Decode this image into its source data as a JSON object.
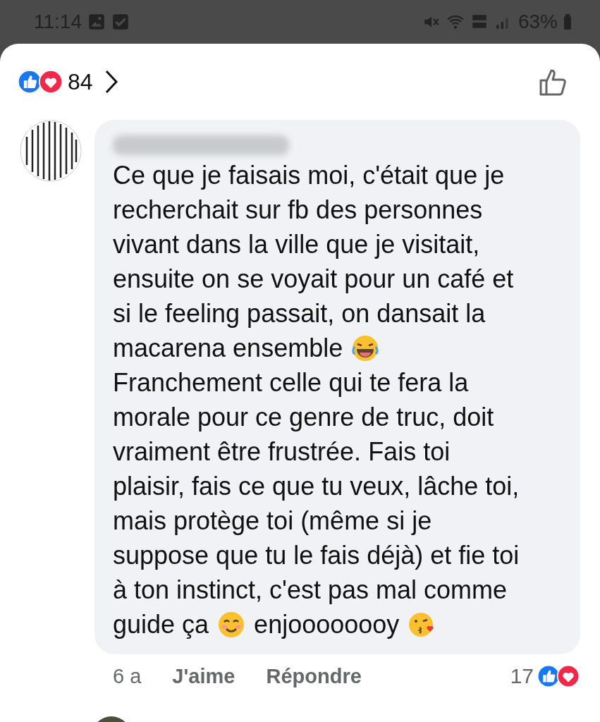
{
  "status_bar": {
    "time": "11:14",
    "battery": "63%"
  },
  "reactions_header": {
    "count": "84"
  },
  "comment": {
    "lines": [
      [
        {
          "kind": "text",
          "text": "Ce que je faisais moi, c'était que je"
        }
      ],
      [
        {
          "kind": "text",
          "text": "recherchait sur fb des personnes"
        }
      ],
      [
        {
          "kind": "text",
          "text": "vivant dans la ville que je visitait,"
        }
      ],
      [
        {
          "kind": "text",
          "text": "ensuite on se voyait pour un café et"
        }
      ],
      [
        {
          "kind": "text",
          "text": "si le feeling passait, on dansait la"
        }
      ],
      [
        {
          "kind": "text",
          "text": "macarena ensemble"
        },
        {
          "kind": "laughing"
        }
      ],
      [
        {
          "kind": "text",
          "text": "Franchement celle qui te fera la"
        }
      ],
      [
        {
          "kind": "text",
          "text": "morale pour ce genre de truc, doit"
        }
      ],
      [
        {
          "kind": "text",
          "text": "vraiment être frustrée. Fais toi"
        }
      ],
      [
        {
          "kind": "text",
          "text": "plaisir, fais ce que tu veux, lâche toi,"
        }
      ],
      [
        {
          "kind": "text",
          "text": "mais protège toi (même si je"
        }
      ],
      [
        {
          "kind": "text",
          "text": "suppose que tu le fais déjà) et fie toi"
        }
      ],
      [
        {
          "kind": "text",
          "text": "à ton instinct, c'est pas mal comme"
        }
      ],
      [
        {
          "kind": "text",
          "text": "guide ça"
        },
        {
          "kind": "smiling"
        },
        {
          "kind": "text",
          "text": "enjoooooooy"
        },
        {
          "kind": "kissing"
        }
      ]
    ],
    "time": "6 a",
    "like_label": "J'aime",
    "reply_label": "Répondre",
    "reaction_count": "17"
  }
}
